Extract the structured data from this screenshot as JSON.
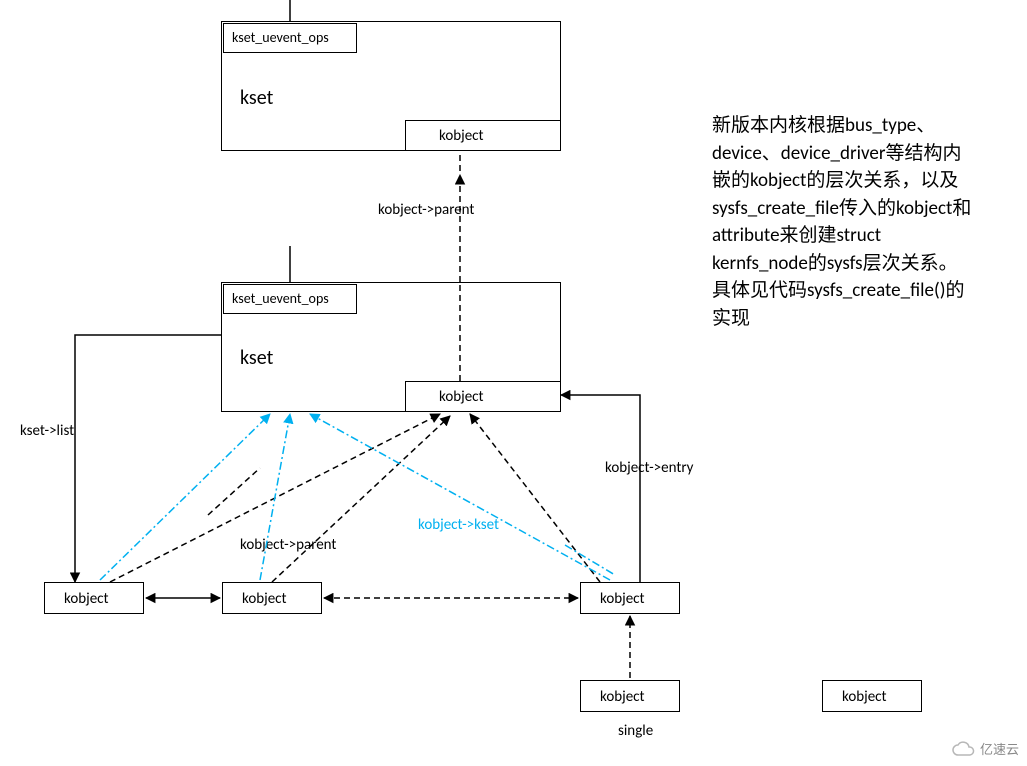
{
  "kset1": {
    "uevent": "kset_uevent_ops",
    "title": "kset",
    "kobject": "kobject"
  },
  "kset2": {
    "uevent": "kset_uevent_ops",
    "title": "kset",
    "kobject": "kobject"
  },
  "child": {
    "k1": "kobject",
    "k2": "kobject",
    "k3": "kobject",
    "k4": "kobject",
    "k5": "kobject"
  },
  "edge": {
    "parent_top": "kobject->parent",
    "kset_list": "kset->list",
    "entry": "kobject->entry",
    "parent_mid": "kobject->parent",
    "kset_mid": "kobject->kset",
    "single": "single"
  },
  "description": "新版本内核根据bus_type、device、device_driver等结构内嵌的kobject的层次关系，以及sysfs_create_file传入的kobject和attribute来创建struct kernfs_node的sysfs层次关系。具体见代码sysfs_create_file()的实现",
  "watermark_a": "",
  "watermark_b": "亿速云"
}
